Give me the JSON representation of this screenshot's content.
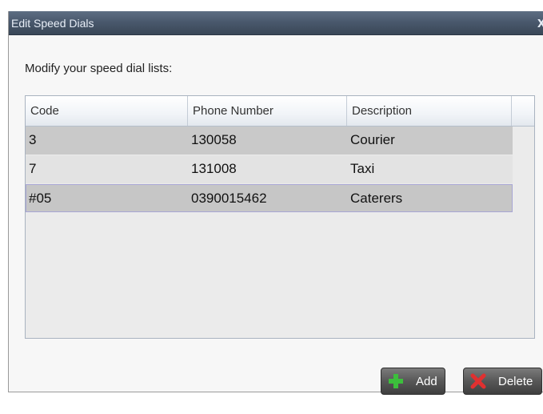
{
  "dialog": {
    "title": "Edit Speed Dials",
    "close_label": "x"
  },
  "instruction": "Modify your speed dial lists:",
  "table": {
    "columns": [
      "Code",
      "Phone Number",
      "Description"
    ],
    "rows": [
      {
        "code": "3",
        "phone": "130058",
        "description": "Courier",
        "selected": false
      },
      {
        "code": "7",
        "phone": "131008",
        "description": "Taxi",
        "selected": false
      },
      {
        "code": "#05",
        "phone": "0390015462",
        "description": "Caterers",
        "selected": true
      }
    ]
  },
  "buttons": {
    "add_label": "Add",
    "add_icon": "plus-icon",
    "delete_label": "Delete",
    "delete_icon": "x-icon"
  },
  "colors": {
    "titlebar": "#4a596d",
    "add_icon": "#3cbf3c",
    "delete_icon": "#e03030"
  }
}
